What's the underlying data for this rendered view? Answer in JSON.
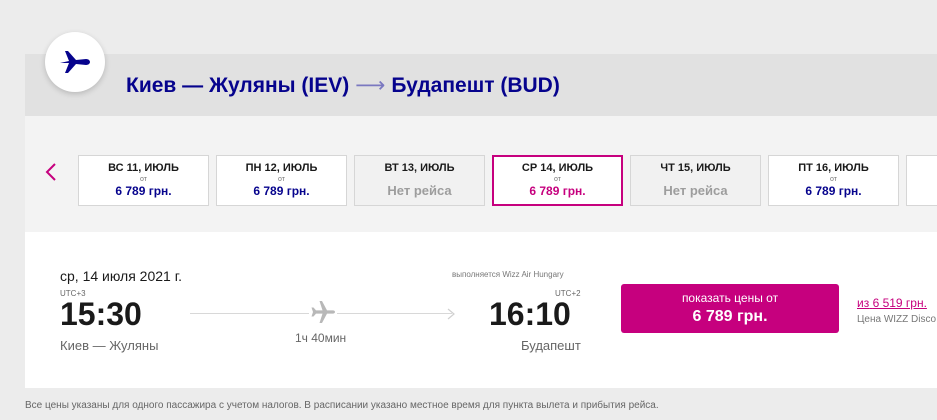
{
  "route": {
    "origin": "Киев — Жуляны (IEV)",
    "arrow": "⟶",
    "destination": "Будапешт (BUD)"
  },
  "icons": {
    "badge": "airplane-icon",
    "prev": "chevron-left-icon",
    "route_plane": "airplane-icon"
  },
  "colors": {
    "brand_blue": "#06038d",
    "brand_magenta": "#c6007e"
  },
  "dates": [
    {
      "label": "ВС 11, ИЮЛЬ",
      "from": "от",
      "price": "6 789 грн.",
      "available": true,
      "selected": false
    },
    {
      "label": "ПН 12, ИЮЛЬ",
      "from": "от",
      "price": "6 789 грн.",
      "available": true,
      "selected": false
    },
    {
      "label": "ВТ 13, ИЮЛЬ",
      "from": "",
      "price": "Нет рейса",
      "available": false,
      "selected": false
    },
    {
      "label": "СР 14, ИЮЛЬ",
      "from": "от",
      "price": "6 789 грн.",
      "available": true,
      "selected": true
    },
    {
      "label": "ЧТ 15, ИЮЛЬ",
      "from": "",
      "price": "Нет рейса",
      "available": false,
      "selected": false
    },
    {
      "label": "ПТ 16, ИЮЛЬ",
      "from": "от",
      "price": "6 789 грн.",
      "available": true,
      "selected": false
    }
  ],
  "flight": {
    "date": "ср, 14 июля 2021 г.",
    "operated_by": "выполняется Wizz Air Hungary",
    "departure": {
      "utc": "UTC+3",
      "time": "15:30",
      "city": "Киев — Жуляны"
    },
    "arrival": {
      "utc": "UTC+2",
      "time": "16:10",
      "city": "Будапешт"
    },
    "duration": "1ч 40мин",
    "button": {
      "top": "показать цены от",
      "price": "6 789 грн."
    },
    "club": {
      "link_prefix": "из",
      "link_price": "6 519 грн.",
      "sub": "Цена WIZZ Disco"
    }
  },
  "footnote": "Все цены указаны для одного пассажира с учетом налогов. В расписании указано местное время для пункта вылета и прибытия рейса."
}
